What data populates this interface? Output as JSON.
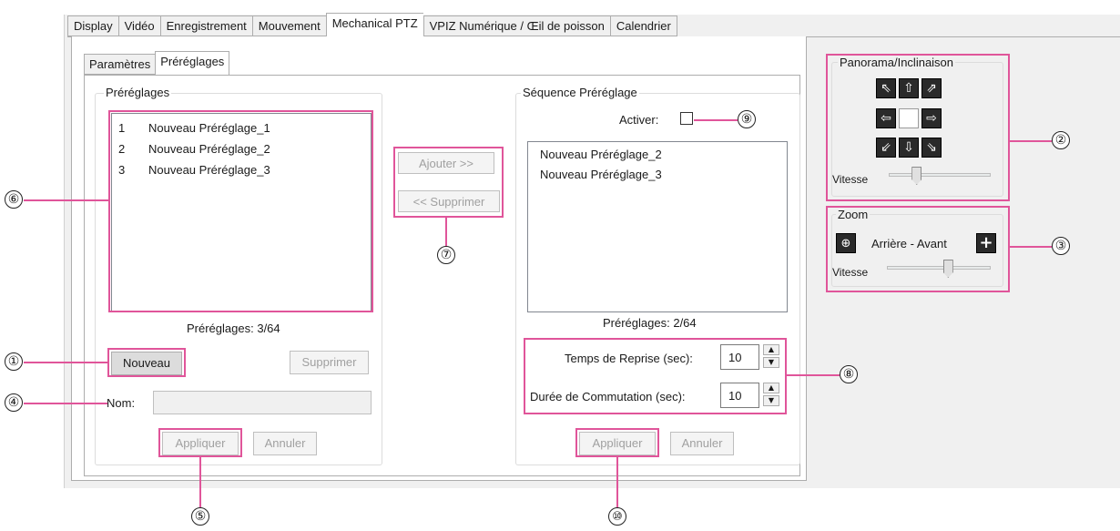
{
  "main_tabs": [
    "Display",
    "Vidéo",
    "Enregistrement",
    "Mouvement",
    "Mechanical PTZ",
    "VPIZ Numérique / Œil de poisson",
    "Calendrier"
  ],
  "sub_tabs": [
    "Paramètres",
    "Préréglages"
  ],
  "presets_group": {
    "title": "Préréglages",
    "items": [
      {
        "num": "1",
        "name": "Nouveau Préréglage_1"
      },
      {
        "num": "2",
        "name": "Nouveau Préréglage_2"
      },
      {
        "num": "3",
        "name": "Nouveau Préréglage_3"
      }
    ],
    "count_label": "Préréglages:",
    "count_value": "3/64",
    "new_button": "Nouveau",
    "delete_button": "Supprimer",
    "name_label": "Nom:",
    "name_value": "",
    "apply_button": "Appliquer",
    "cancel_button": "Annuler"
  },
  "middle": {
    "add_button": "Ajouter >>",
    "remove_button": "<< Supprimer"
  },
  "sequence_group": {
    "title": "Séquence Préréglage",
    "enable_label": "Activer:",
    "enable_checked": false,
    "items": [
      "Nouveau Préréglage_2",
      "Nouveau Préréglage_3"
    ],
    "count_label": "Préréglages:",
    "count_value": "2/64",
    "resume_label": "Temps de Reprise (sec):",
    "resume_value": "10",
    "switch_label": "Durée de Commutation (sec):",
    "switch_value": "10",
    "apply_button": "Appliquer",
    "cancel_button": "Annuler"
  },
  "pan_tilt": {
    "title": "Panorama/Inclinaison",
    "speed_label": "Vitesse",
    "speed_level": 0.25,
    "arrows": {
      "up_left": "⇖",
      "up": "⇧",
      "up_right": "⇗",
      "left": "⇦",
      "right": "⇨",
      "down_left": "⇙",
      "down": "⇩",
      "down_right": "⇘"
    }
  },
  "zoom": {
    "title": "Zoom",
    "out_icon": "⊕",
    "label": "Arrière - Avant",
    "in_icon": "+",
    "speed_label": "Vitesse",
    "speed_level": 0.6
  },
  "callouts": [
    "①",
    "②",
    "③",
    "④",
    "⑤",
    "⑥",
    "⑦",
    "⑧",
    "⑨",
    "⑩"
  ],
  "colors": {
    "highlight": "#e0559a",
    "window_bg": "#f0f0f0"
  }
}
